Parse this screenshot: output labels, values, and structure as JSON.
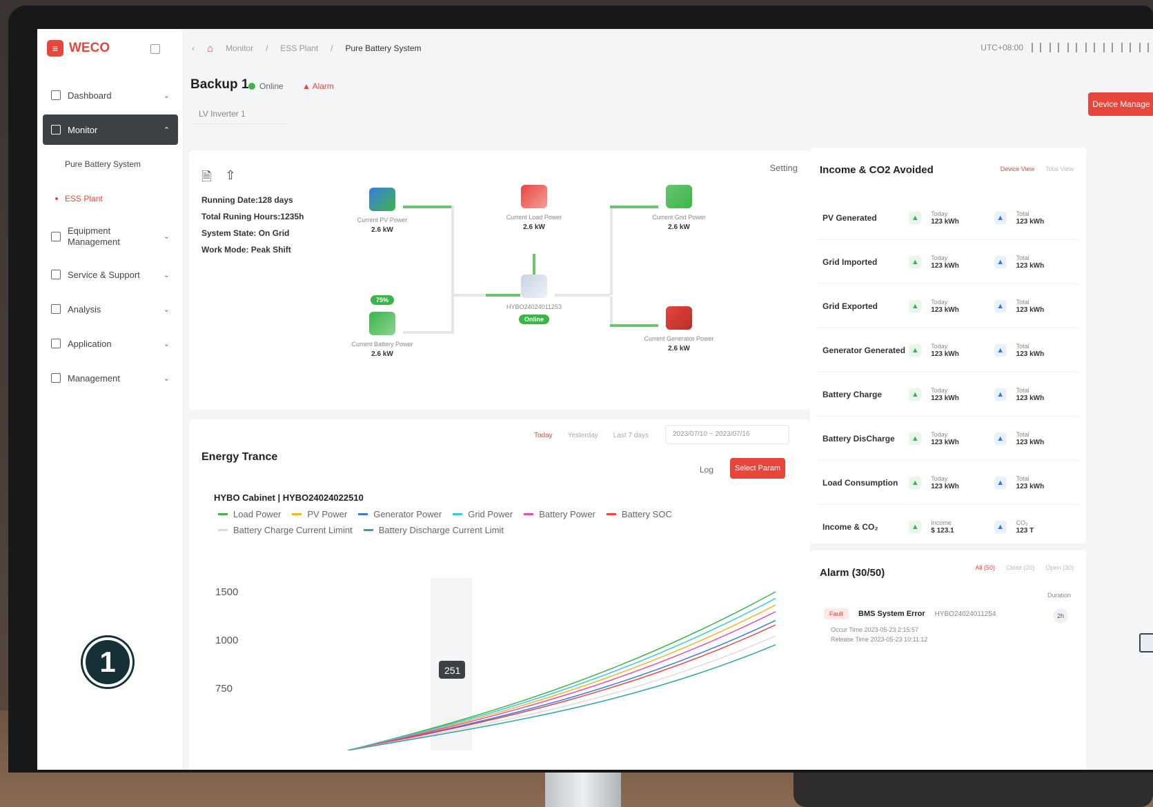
{
  "brand": {
    "name": "WECO"
  },
  "sidebar": {
    "items": [
      {
        "label": "Dashboard",
        "icon": "dashboard-icon"
      },
      {
        "label": "Monitor",
        "icon": "monitor-icon"
      },
      {
        "label": "Pure Battery System"
      },
      {
        "label": "ESS Plant"
      },
      {
        "label": "Equipment Management",
        "icon": "equipment-icon"
      },
      {
        "label": "Service & Support",
        "icon": "support-icon"
      },
      {
        "label": "Analysis",
        "icon": "analysis-icon"
      },
      {
        "label": "Application",
        "icon": "application-icon"
      },
      {
        "label": "Management",
        "icon": "management-icon"
      }
    ]
  },
  "breadcrumb": {
    "items": [
      "Monitor",
      "ESS Plant",
      "Pure Battery System"
    ]
  },
  "topbar": {
    "timezone": "UTC+08:00"
  },
  "header": {
    "title": "Backup 1",
    "status": "Online",
    "alarm": "Alarm",
    "inverter": "LV Inverter 1",
    "device_manage": "Device Manage"
  },
  "flow": {
    "setting": "Setting",
    "stats": [
      "Running Date:128 days",
      "Total Runing Hours:1235h",
      "System State: On Grid",
      "Work Mode: Peak Shift"
    ],
    "nodes": {
      "pv": {
        "label": "Current PV Power",
        "value": "2.6 kW"
      },
      "load": {
        "label": "Current Load Power",
        "value": "2.6 kW"
      },
      "grid": {
        "label": "Current Grid Power",
        "value": "2.6 kW"
      },
      "battery": {
        "label": "Current Battery Power",
        "value": "2.6 kW",
        "soc": "75%"
      },
      "inverter": {
        "label": "HYBO24024011253",
        "status": "Online"
      },
      "generator": {
        "label": "Current Generator Power",
        "value": "2.6 kW"
      }
    }
  },
  "energy": {
    "title": "Energy Trance",
    "tabs": [
      "Today",
      "Yesterday",
      "Last 7 days"
    ],
    "date_range": "2023/07/10 ~ 2023/07/16",
    "log": "Log",
    "select_param": "Select Param",
    "cabinet": "HYBO Cabinet",
    "cabinet_id": "HYBO24024022510",
    "tooltip": "251"
  },
  "chart_data": {
    "type": "line",
    "series": [
      {
        "name": "Load Power",
        "color": "#3bb54a"
      },
      {
        "name": "PV Power",
        "color": "#f0b429"
      },
      {
        "name": "Generator Power",
        "color": "#3a7be0"
      },
      {
        "name": "Grid Power",
        "color": "#3cc6e0"
      },
      {
        "name": "Battery Power",
        "color": "#e04fa8"
      },
      {
        "name": "Battery SOC",
        "color": "#e8453c"
      },
      {
        "name": "Battery Charge Current Limint",
        "color": "#d9dcdf"
      },
      {
        "name": "Battery Discharge Current Limit",
        "color": "#2fa3a0"
      }
    ],
    "y_ticks": [
      "1500",
      "1000",
      "750"
    ]
  },
  "income": {
    "title": "Income & CO2 Avoided",
    "views": [
      "Device View",
      "Total View"
    ],
    "rows": [
      {
        "label": "PV Generated",
        "today_label": "Today",
        "today": "123 kWh",
        "total_label": "Total",
        "total": "123 kWh"
      },
      {
        "label": "Grid Imported",
        "today_label": "Today",
        "today": "123 kWh",
        "total_label": "Total",
        "total": "123 kWh"
      },
      {
        "label": "Grid Exported",
        "today_label": "Today",
        "today": "123 kWh",
        "total_label": "Total",
        "total": "123 kWh"
      },
      {
        "label": "Generator Generated",
        "today_label": "Today",
        "today": "123 kWh",
        "total_label": "Total",
        "total": "123 kWh"
      },
      {
        "label": "Battery Charge",
        "today_label": "Today",
        "today": "123 kWh",
        "total_label": "Total",
        "total": "123 kWh"
      },
      {
        "label": "Battery DisCharge",
        "today_label": "Today",
        "today": "123 kWh",
        "total_label": "Total",
        "total": "123 kWh"
      },
      {
        "label": "Load Consumption",
        "today_label": "Today",
        "today": "123 kWh",
        "total_label": "Total",
        "total": "123 kWh"
      },
      {
        "label": "Income & CO₂",
        "today_label": "Income",
        "today": "$ 123.1",
        "total_label": "CO₂",
        "total": "123 T"
      }
    ]
  },
  "alarm": {
    "title": "Alarm (30/50)",
    "tabs": [
      "All (50)",
      "Close (20)",
      "Open (30)"
    ],
    "duration_label": "Duration",
    "item": {
      "level": "Fault",
      "name": "BMS System Error",
      "device": "HYBO24024011254",
      "occur": "Occur Time  2023-05-23 2:15:57",
      "release": "Release Time  2023-05-23 10:11:12",
      "duration": "2h"
    }
  },
  "badge": "1"
}
